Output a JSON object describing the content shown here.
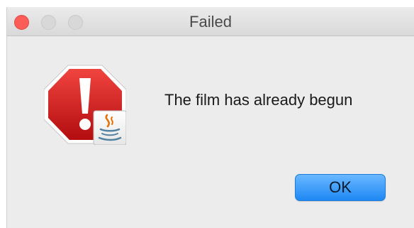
{
  "window": {
    "title": "Failed"
  },
  "dialog": {
    "icon": "stop-alert-with-java-badge-icon",
    "message": "The film has already begun",
    "ok_label": "OK"
  },
  "colors": {
    "close_button": "#fc5d57",
    "inactive_button": "#d8d8d8",
    "alert_red": "#d8191b",
    "primary_button": "#1e88f5"
  }
}
